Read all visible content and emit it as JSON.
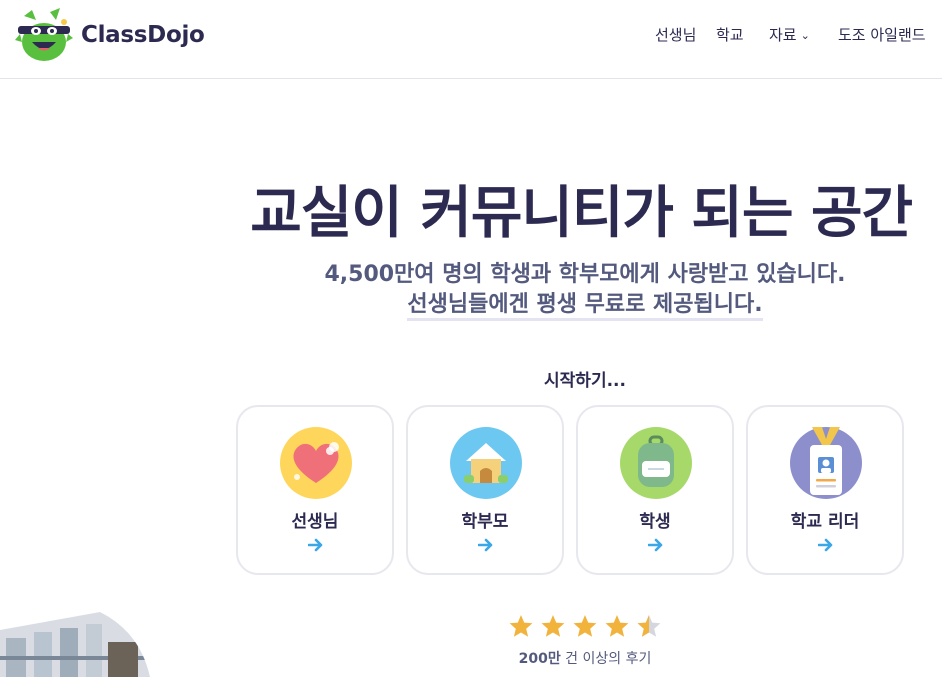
{
  "header": {
    "brand": "ClassDojo",
    "nav": [
      {
        "label": "선생님"
      },
      {
        "label": "학교"
      },
      {
        "label": "자료",
        "chevron": "⌄"
      },
      {
        "label": "도조 아일랜드"
      }
    ]
  },
  "hero": {
    "title": "교실이 커뮤니티가 되는 공간",
    "subtitle_line1": "4,500만여 명의 학생과 학부모에게 사랑받고 있습니다.",
    "subtitle_line2": "선생님들에겐 평생 무료로 제공됩니다."
  },
  "get_started": {
    "label": "시작하기...",
    "cards": [
      {
        "label": "선생님",
        "icon": "heart-icon",
        "icon_bg": "#ffd65c"
      },
      {
        "label": "학부모",
        "icon": "house-icon",
        "icon_bg": "#6cc8f0"
      },
      {
        "label": "학생",
        "icon": "backpack-icon",
        "icon_bg": "#a6d96a"
      },
      {
        "label": "학교 리더",
        "icon": "id-badge-icon",
        "icon_bg": "#8c8fcc"
      }
    ]
  },
  "rating": {
    "stars": 4.5,
    "reviews_count": "200만",
    "reviews_text": " 건 이상의 후기"
  },
  "colors": {
    "text_dark": "#2c2a50",
    "text_muted": "#545a7e",
    "arrow_blue": "#3aa7e6",
    "star_gold": "#f2b33d",
    "logo_green": "#59c03f"
  }
}
